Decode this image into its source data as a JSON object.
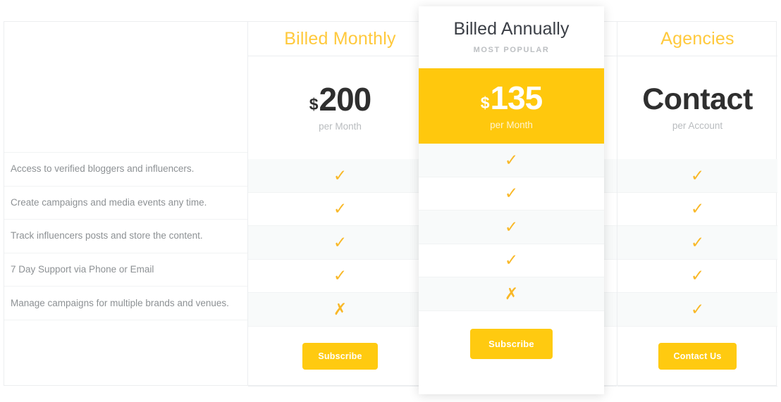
{
  "features": [
    "Access to verified bloggers and influencers.",
    "Create campaigns and media events any time.",
    "Track influencers posts and store the content.",
    "7 Day Support via Phone or Email",
    "Manage campaigns for multiple brands and venues."
  ],
  "icons": {
    "check": "✓",
    "cross": "✗"
  },
  "colors": {
    "accent_yellow": "#ffc80d",
    "header_yellow": "#ffc93c",
    "mark_yellow": "#f9b827",
    "dark_text": "#2f2f2f",
    "muted_text": "#8d9194"
  },
  "plans": [
    {
      "id": "monthly",
      "title": "Billed Monthly",
      "currency": "$",
      "amount": "200",
      "period": "per Month",
      "marks": [
        "✓",
        "✓",
        "✓",
        "✓",
        "✗"
      ],
      "cta": "Subscribe"
    },
    {
      "id": "annually",
      "title": "Billed Annually",
      "badge": "MOST POPULAR",
      "currency": "$",
      "amount": "135",
      "period": "per Month",
      "marks": [
        "✓",
        "✓",
        "✓",
        "✓",
        "✗"
      ],
      "cta": "Subscribe"
    },
    {
      "id": "agencies",
      "title": "Agencies",
      "currency": "",
      "amount": "Contact",
      "period": "per Account",
      "marks": [
        "✓",
        "✓",
        "✓",
        "✓",
        "✓"
      ],
      "cta": "Contact Us"
    }
  ]
}
